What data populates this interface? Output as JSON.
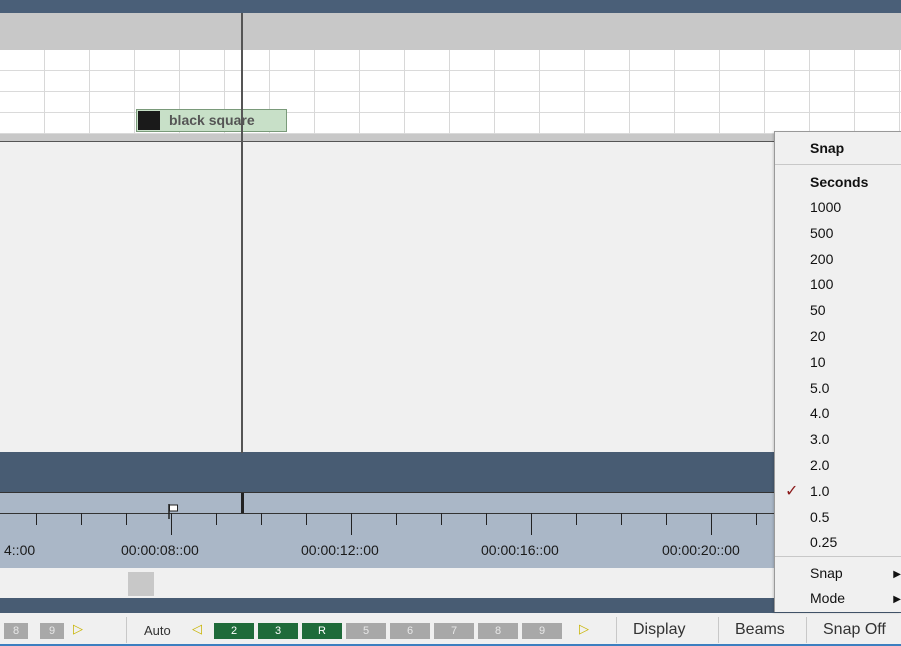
{
  "track": {
    "clip_label": "black square"
  },
  "ruler": {
    "labels": [
      "4::00",
      "00:00:08::00",
      "00:00:12::00",
      "00:00:16::00",
      "00:00:20::00"
    ]
  },
  "toolbar": {
    "left_numbers": [
      "8",
      "9"
    ],
    "auto_label": "Auto",
    "cells": [
      {
        "label": "2",
        "state": "active"
      },
      {
        "label": "3",
        "state": "active"
      },
      {
        "label": "R",
        "state": "active"
      },
      {
        "label": "5",
        "state": "inactive"
      },
      {
        "label": "6",
        "state": "inactive"
      },
      {
        "label": "7",
        "state": "inactive"
      },
      {
        "label": "8",
        "state": "inactive"
      },
      {
        "label": "9",
        "state": "inactive"
      }
    ],
    "display_label": "Display",
    "beams_label": "Beams",
    "snap_label": "Snap Off"
  },
  "snap_menu": {
    "title": "Snap",
    "section_label": "Seconds",
    "options": [
      "1000",
      "500",
      "200",
      "100",
      "50",
      "20",
      "10",
      "5.0",
      "4.0",
      "3.0",
      "2.0",
      "1.0",
      "0.5",
      "0.25"
    ],
    "selected": "1.0",
    "submenus": [
      "Snap",
      "Mode"
    ]
  },
  "colors": {
    "header_dark": "#485c73",
    "clip_fill": "#c8e0c8",
    "active_cell": "#1f6b3a",
    "check_mark": "#8b1a1a"
  },
  "icons": {
    "check": "✓",
    "submenu_arrow": "▶",
    "left_arrow": "◁",
    "right_arrow": "▷"
  }
}
